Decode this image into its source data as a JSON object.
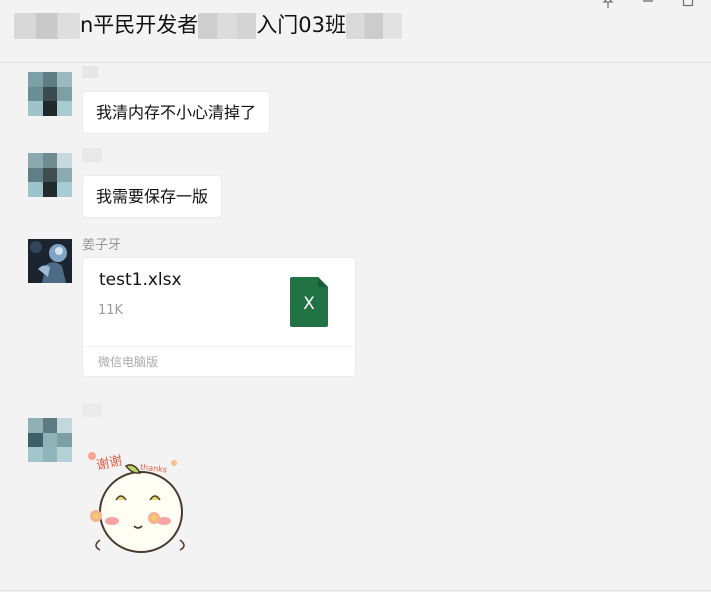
{
  "header": {
    "title_part1": "n平民开发者",
    "title_part2": "入门03班"
  },
  "window_controls": [
    {
      "name": "pin-icon"
    },
    {
      "name": "minimize-icon"
    },
    {
      "name": "maximize-icon"
    }
  ],
  "messages": [
    {
      "type": "text",
      "text": "我清内存不小心清掉了"
    },
    {
      "type": "text",
      "text": "我需要保存一版"
    },
    {
      "type": "file",
      "sender": "姜子牙",
      "file_name": "test1.xlsx",
      "file_size": "11K",
      "file_icon_letter": "X",
      "source": "微信电脑版",
      "icon_color": "#217346"
    },
    {
      "type": "sticker",
      "sticker_text": "谢谢",
      "sticker_text_en": "thanks"
    }
  ]
}
